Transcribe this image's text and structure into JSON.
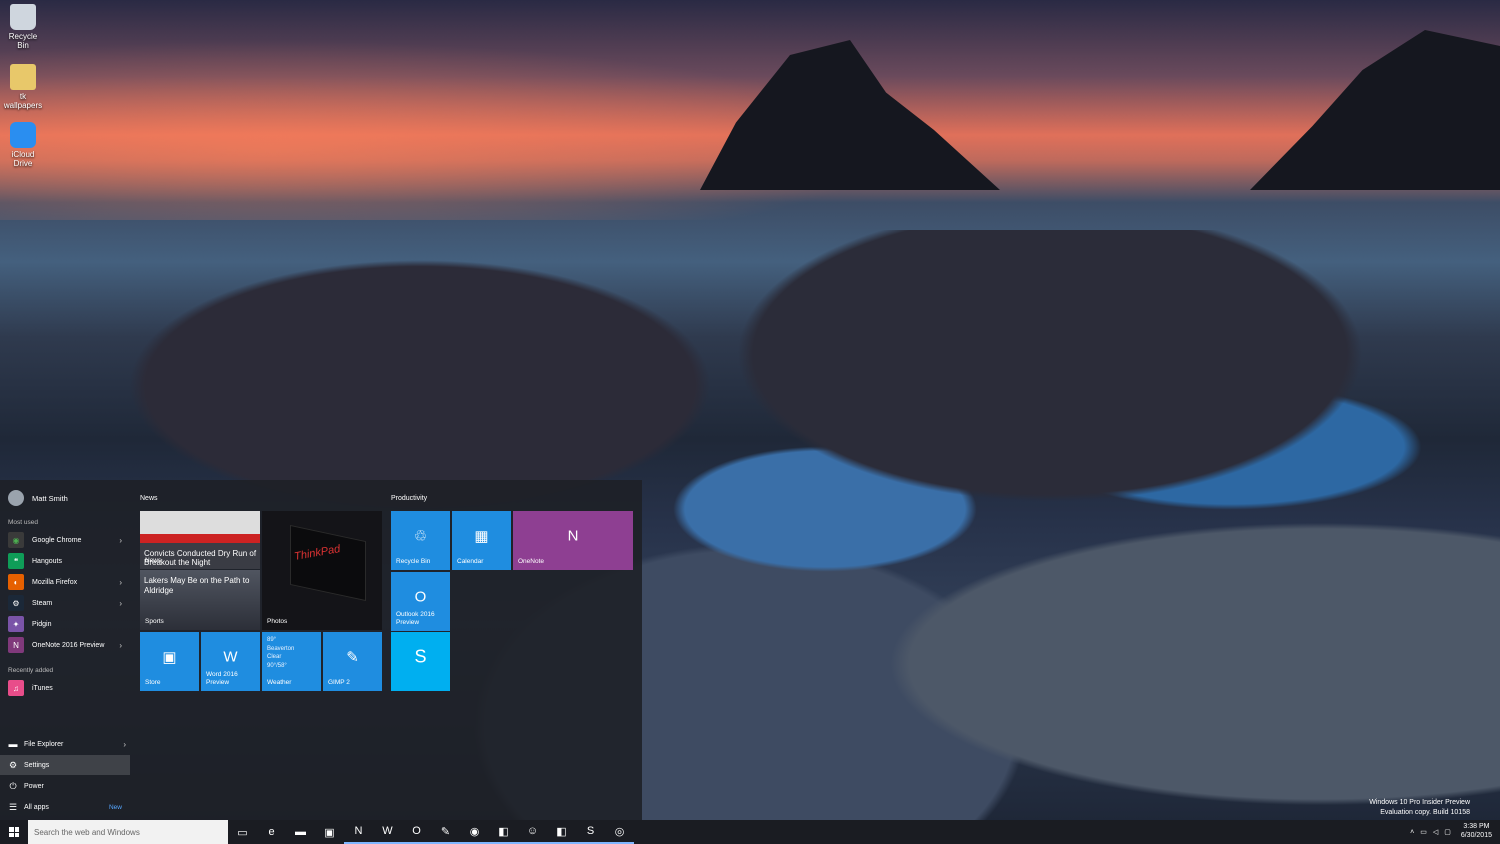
{
  "desktop": {
    "icons": [
      {
        "label": "Recycle Bin",
        "icon": "recycle-bin-icon"
      },
      {
        "label": "tk wallpapers",
        "icon": "folder-icon"
      },
      {
        "label": "iCloud Drive",
        "icon": "icloud-icon"
      }
    ],
    "watermark": {
      "line1": "Windows 10 Pro Insider Preview",
      "line2": "Evaluation copy. Build 10158"
    }
  },
  "start_menu": {
    "user": "Matt Smith",
    "most_used_label": "Most used",
    "most_used": [
      {
        "label": "Google Chrome",
        "icon": "chrome-icon",
        "color": "#2a2a2a",
        "has_submenu": true
      },
      {
        "label": "Hangouts",
        "icon": "hangouts-icon",
        "color": "#0f9d58",
        "has_submenu": false
      },
      {
        "label": "Mozilla Firefox",
        "icon": "firefox-icon",
        "color": "#e66000",
        "has_submenu": true
      },
      {
        "label": "Steam",
        "icon": "steam-icon",
        "color": "#1b2838",
        "has_submenu": true
      },
      {
        "label": "Pidgin",
        "icon": "pidgin-icon",
        "color": "#7a54a8",
        "has_submenu": false
      },
      {
        "label": "OneNote 2016 Preview",
        "icon": "onenote-icon",
        "color": "#80397b",
        "has_submenu": true
      }
    ],
    "recently_added_label": "Recently added",
    "recently_added": [
      {
        "label": "iTunes",
        "icon": "itunes-icon",
        "color": "#e84d8a"
      }
    ],
    "system": [
      {
        "label": "File Explorer",
        "icon": "file-explorer-icon",
        "has_submenu": true
      },
      {
        "label": "Settings",
        "icon": "gear-icon",
        "has_submenu": false
      },
      {
        "label": "Power",
        "icon": "power-icon",
        "has_submenu": false
      },
      {
        "label": "All apps",
        "icon": "all-apps-icon",
        "badge": "New"
      }
    ],
    "groups": {
      "news": "News",
      "productivity": "Productivity"
    },
    "tiles": {
      "news_headline": "Convicts Conducted Dry Run of Breakout the Night",
      "news_label": "News",
      "sports_headline": "Lakers May Be on the Path to Aldridge",
      "sports_label": "Sports",
      "photos_label": "Photos",
      "photos_text": "ThinkPad",
      "store_label": "Store",
      "word_label": "Word 2016 Preview",
      "weather_label": "Weather",
      "weather_temp": "89°",
      "weather_city": "Beaverton",
      "weather_cond": "Clear",
      "weather_range": "90°/58°",
      "gimp_label": "GIMP 2",
      "recycle_label": "Recycle Bin",
      "calendar_label": "Calendar",
      "onenote_label": "OneNote",
      "outlook_label": "Outlook 2016 Preview",
      "skype_label": ""
    }
  },
  "taskbar": {
    "search_placeholder": "Search the web and Windows",
    "apps": [
      {
        "name": "task-view-icon",
        "glyph": "▭",
        "active": false
      },
      {
        "name": "edge-icon",
        "glyph": "e",
        "active": false
      },
      {
        "name": "file-explorer-icon",
        "glyph": "▬",
        "active": false
      },
      {
        "name": "store-icon",
        "glyph": "▣",
        "active": false
      },
      {
        "name": "onenote-icon",
        "glyph": "N",
        "active": true
      },
      {
        "name": "word-icon",
        "glyph": "W",
        "active": true
      },
      {
        "name": "outlook-icon",
        "glyph": "O",
        "active": true
      },
      {
        "name": "gimp-icon",
        "glyph": "✎",
        "active": true
      },
      {
        "name": "chrome-icon",
        "glyph": "◉",
        "active": true
      },
      {
        "name": "hangouts-icon",
        "glyph": "◧",
        "active": true
      },
      {
        "name": "pidgin-icon",
        "glyph": "☺",
        "active": true
      },
      {
        "name": "hangouts-2-icon",
        "glyph": "◧",
        "active": true
      },
      {
        "name": "skype-icon",
        "glyph": "S",
        "active": true
      },
      {
        "name": "spotify-icon",
        "glyph": "◎",
        "active": true
      }
    ],
    "time": "3:38 PM",
    "date": "6/30/2015"
  }
}
